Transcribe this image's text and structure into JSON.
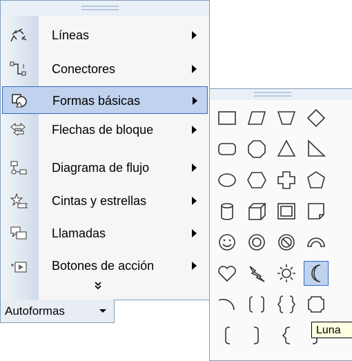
{
  "menu": {
    "items": [
      {
        "label": "Líneas",
        "icon": "lines-icon",
        "submenu": true
      },
      {
        "label": "Conectores",
        "icon": "connectors-icon",
        "submenu": true
      },
      {
        "label": "Formas básicas",
        "icon": "basic-shapes-icon",
        "submenu": true,
        "selected": true
      },
      {
        "label": "Flechas de bloque",
        "icon": "block-arrows-icon",
        "submenu": true
      },
      {
        "label": "Diagrama de flujo",
        "icon": "flowchart-icon",
        "submenu": true
      },
      {
        "label": "Cintas y estrellas",
        "icon": "stars-banners-icon",
        "submenu": true
      },
      {
        "label": "Llamadas",
        "icon": "callouts-icon",
        "submenu": true
      },
      {
        "label": "Botones de acción",
        "icon": "action-buttons-icon",
        "submenu": true
      }
    ],
    "expand": "expand-chevron-icon"
  },
  "toolbar": {
    "label": "Autoformas"
  },
  "palette": {
    "shapes": [
      "rectangle",
      "parallelogram",
      "trapezoid",
      "diamond",
      "rounded-rectangle",
      "octagon",
      "isosceles-triangle",
      "right-triangle",
      "oval",
      "hexagon",
      "cross",
      "pentagon",
      "can",
      "cube",
      "bevel",
      "folded-corner",
      "smiley-face",
      "donut",
      "no-symbol",
      "block-arc",
      "heart",
      "lightning-bolt",
      "sun",
      "moon",
      "arc",
      "double-bracket",
      "double-brace",
      "plaque",
      "left-bracket",
      "right-bracket",
      "left-brace",
      "right-brace"
    ],
    "highlighted": "moon",
    "accent": "#316ac5",
    "highlight_bg": "#c1d2ee"
  },
  "tooltip": {
    "label": "Luna"
  }
}
